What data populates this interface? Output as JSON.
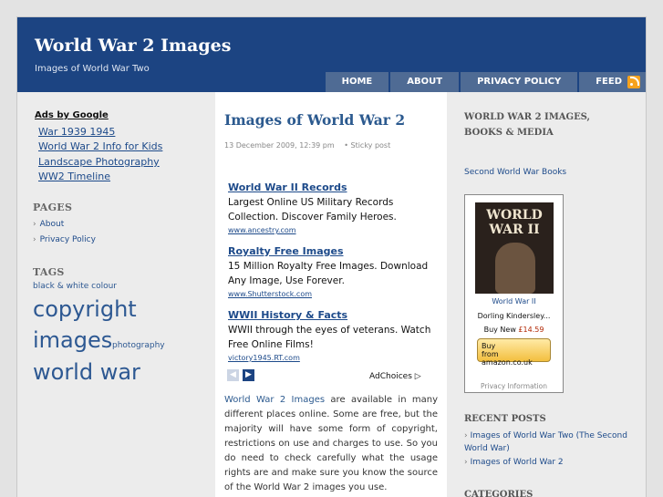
{
  "header": {
    "title": "World War 2 Images",
    "description": "Images of World War Two",
    "nav": [
      "HOME",
      "ABOUT",
      "PRIVACY POLICY",
      "FEED"
    ],
    "feed_icon": "rss-icon"
  },
  "left_sidebar": {
    "ads_label": "Ads by Google",
    "ad_links": [
      "War 1939 1945",
      "World War 2 Info for Kids",
      "Landscape Photography",
      "WW2 Timeline"
    ],
    "pages_heading": "PAGES",
    "pages": [
      "About",
      "Privacy Policy"
    ],
    "tags_heading": "TAGS",
    "tags": [
      "black & white colour",
      "copyright",
      "images",
      "photography",
      "world war"
    ]
  },
  "post": {
    "title": "Images of World War 2",
    "date": "13 December 2009, 12:39 pm",
    "sticky": "Sticky post",
    "ads": [
      {
        "title": "World War II Records",
        "text": "Largest Online US Military Records Collection. Discover Family Heroes.",
        "url": "www.ancestry.com"
      },
      {
        "title": "Royalty Free Images",
        "text": "15 Million Royalty Free Images. Download Any Image, Use Forever.",
        "url": "www.Shutterstock.com"
      },
      {
        "title": "WWII History & Facts",
        "text": "WWII through the eyes of veterans. Watch Free Online Films!",
        "url": "victory1945.RT.com"
      }
    ],
    "adchoices": "AdChoices",
    "body_link": "World War 2 Images",
    "body": " are available in many different places online. Some are free, but the majority will have some form of copyright, restrictions on use and charges to use. So you do need to check carefully what the usage rights are and make sure you know the source of the World War 2 images you use."
  },
  "right_sidebar": {
    "heading": "WORLD WAR 2 IMAGES, BOOKS & MEDIA",
    "books_link": "Second World War Books",
    "product": {
      "cover_line1": "WORLD",
      "cover_line2": "WAR II",
      "title": "World War II",
      "author": "Dorling Kindersley...",
      "price_label": "Buy New",
      "price": "£14.59",
      "buy_line1": "Buy",
      "buy_line2": "from amazon.co.uk",
      "privacy": "Privacy Information"
    },
    "recent_heading": "RECENT POSTS",
    "recent_posts": [
      "Images of World War Two (The Second World War)",
      "Images of World War 2"
    ],
    "categories_heading": "CATEGORIES"
  }
}
